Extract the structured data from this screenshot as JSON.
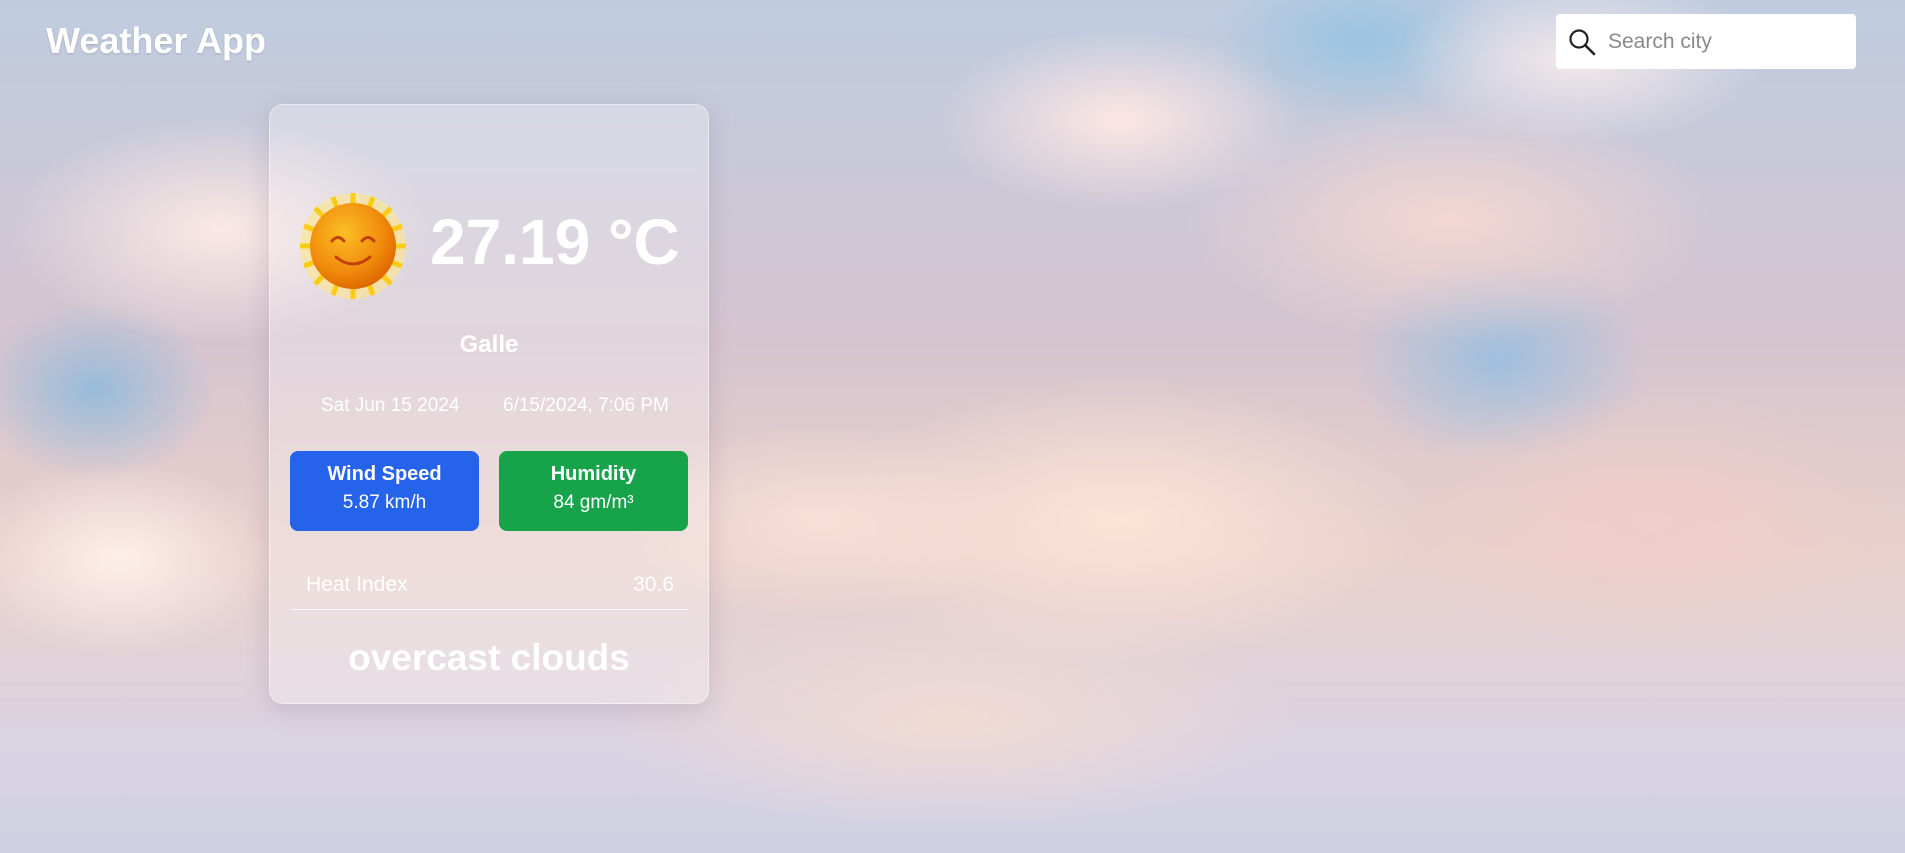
{
  "app": {
    "title": "Weather App"
  },
  "search": {
    "placeholder": "Search city",
    "value": "",
    "icon": "search-icon"
  },
  "weather": {
    "icon": "sun-icon",
    "temperature": "27.19 °C",
    "city": "Galle",
    "date": "Sat Jun 15 2024",
    "datetime": "6/15/2024, 7:06 PM",
    "wind": {
      "label": "Wind Speed",
      "value": "5.87 km/h",
      "color": "#2563eb"
    },
    "humidity": {
      "label": "Humidity",
      "value": "84 gm/m³",
      "color": "#16a34a"
    },
    "heat_index": {
      "label": "Heat Index",
      "value": "30.6"
    },
    "description": "overcast clouds"
  }
}
